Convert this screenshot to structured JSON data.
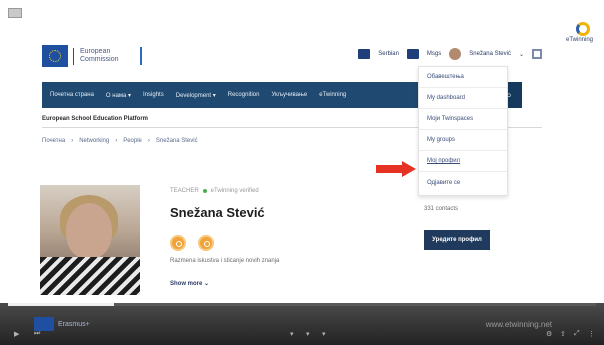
{
  "header": {
    "ec_logo_line1": "European",
    "ec_logo_line2": "Commission",
    "lang_label": "Serbian",
    "messages_label": "Msgs",
    "user_label": "Snežana Stević",
    "etwinning_logo": "eTwinning"
  },
  "nav": {
    "items": [
      "Почетна страна",
      "О нама ▾",
      "Insights",
      "Development ▾",
      "Recognition",
      "Укључивање",
      "eTwinning"
    ],
    "search_icon": "search-icon"
  },
  "platform_title": "European School Education Platform",
  "breadcrumb": [
    "Почетна",
    "›",
    "Networking",
    "›",
    "People",
    "›",
    "Snežana Stević"
  ],
  "profile": {
    "role": "TEACHER",
    "status": "eTwinning verified",
    "name": "Snežana Stević",
    "bio": "Razmena iskustva i sticanje novih znanja",
    "show_more": "Show more  ⌄",
    "contacts": "331 contacts",
    "edit_profile_button": "Уредите профил"
  },
  "dropdown": {
    "items": [
      "Обавештења",
      "My dashboard",
      "Моји Twinspaces",
      "My groups",
      "Мој профил",
      "Одјавите се"
    ],
    "highlighted_index": 4
  },
  "player": {
    "logo_text": "Erasmus+",
    "url": "www.etwinning.net",
    "progress": 0.18
  },
  "colors": {
    "nav_bg": "#1f4970",
    "accent_arrow": "#e53223",
    "button_bg": "#1f3a5c",
    "badge": "#f0a33a"
  }
}
